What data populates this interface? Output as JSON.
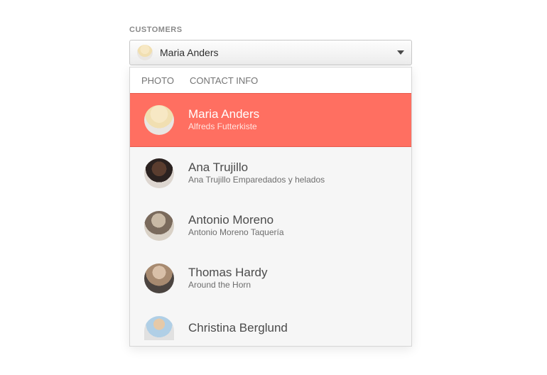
{
  "label": "CUSTOMERS",
  "selected": {
    "name": "Maria Anders",
    "avatar_class": "av1"
  },
  "columns": {
    "photo": "PHOTO",
    "contact": "CONTACT INFO"
  },
  "items": [
    {
      "name": "Maria Anders",
      "company": "Alfreds Futterkiste",
      "avatar_class": "av1",
      "selected": true
    },
    {
      "name": "Ana Trujillo",
      "company": "Ana Trujillo Emparedados y helados",
      "avatar_class": "av2",
      "selected": false
    },
    {
      "name": "Antonio Moreno",
      "company": "Antonio Moreno Taquería",
      "avatar_class": "av3",
      "selected": false
    },
    {
      "name": "Thomas Hardy",
      "company": "Around the Horn",
      "avatar_class": "av4",
      "selected": false
    },
    {
      "name": "Christina Berglund",
      "company": "",
      "avatar_class": "av5",
      "selected": false,
      "cut": true
    }
  ],
  "colors": {
    "accent": "#ff6f61"
  }
}
